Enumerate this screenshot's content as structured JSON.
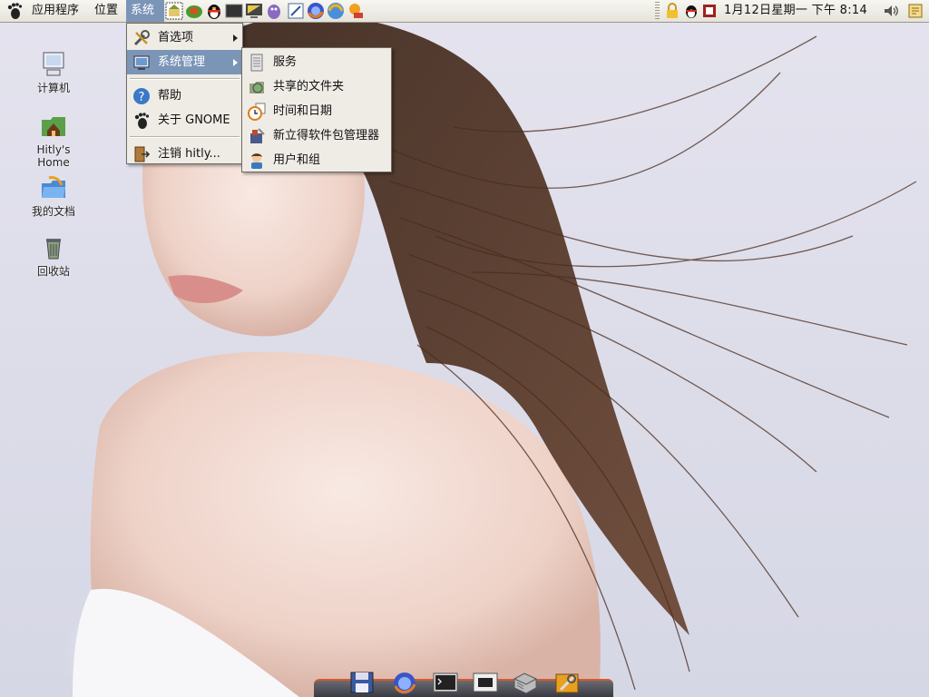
{
  "panel": {
    "menus": {
      "applications": "应用程序",
      "places": "位置",
      "system": "系统"
    },
    "clock": "1月12日星期一 下午 8:14",
    "launchers": [
      "home-folder-icon",
      "turtle-icon",
      "qq-penguin-icon",
      "terminal-icon",
      "monitor-icon",
      "pidgin-icon",
      "text-editor-icon",
      "firefox-icon",
      "globe-icon",
      "weather-icon"
    ],
    "tray": [
      "lock-icon",
      "qq-penguin-icon",
      "app-icon",
      "volume-icon",
      "notes-icon"
    ]
  },
  "desktop": {
    "icons": [
      {
        "label": "计算机",
        "icon": "computer-icon"
      },
      {
        "label": "Hitly's Home",
        "icon": "home-icon"
      },
      {
        "label": "我的文档",
        "icon": "documents-icon"
      },
      {
        "label": "回收站",
        "icon": "trash-icon"
      }
    ]
  },
  "system_menu": {
    "items": [
      {
        "label": "首选项",
        "icon": "tools-icon",
        "submenu": true
      },
      {
        "label": "系统管理",
        "icon": "admin-icon",
        "submenu": true,
        "highlighted": true
      },
      {
        "label": "帮助",
        "icon": "help-icon"
      },
      {
        "label": "关于 GNOME",
        "icon": "gnome-foot-icon"
      },
      {
        "label": "注销 hitly...",
        "icon": "logout-icon"
      }
    ]
  },
  "admin_submenu": {
    "items": [
      {
        "label": "服务",
        "icon": "services-icon"
      },
      {
        "label": "共享的文件夹",
        "icon": "shared-folder-icon"
      },
      {
        "label": "时间和日期",
        "icon": "clock-icon"
      },
      {
        "label": "新立得软件包管理器",
        "icon": "package-manager-icon"
      },
      {
        "label": "用户和组",
        "icon": "users-icon"
      }
    ]
  },
  "dock": {
    "icons": [
      "save-icon",
      "firefox-icon",
      "terminal-icon",
      "display-icon",
      "drive-icon",
      "settings-icon"
    ]
  },
  "colors": {
    "panel_bg": "#efece4",
    "menu_bg": "#efece6",
    "highlight": "#7b95b7",
    "dock_accent": "#d85a2a"
  }
}
